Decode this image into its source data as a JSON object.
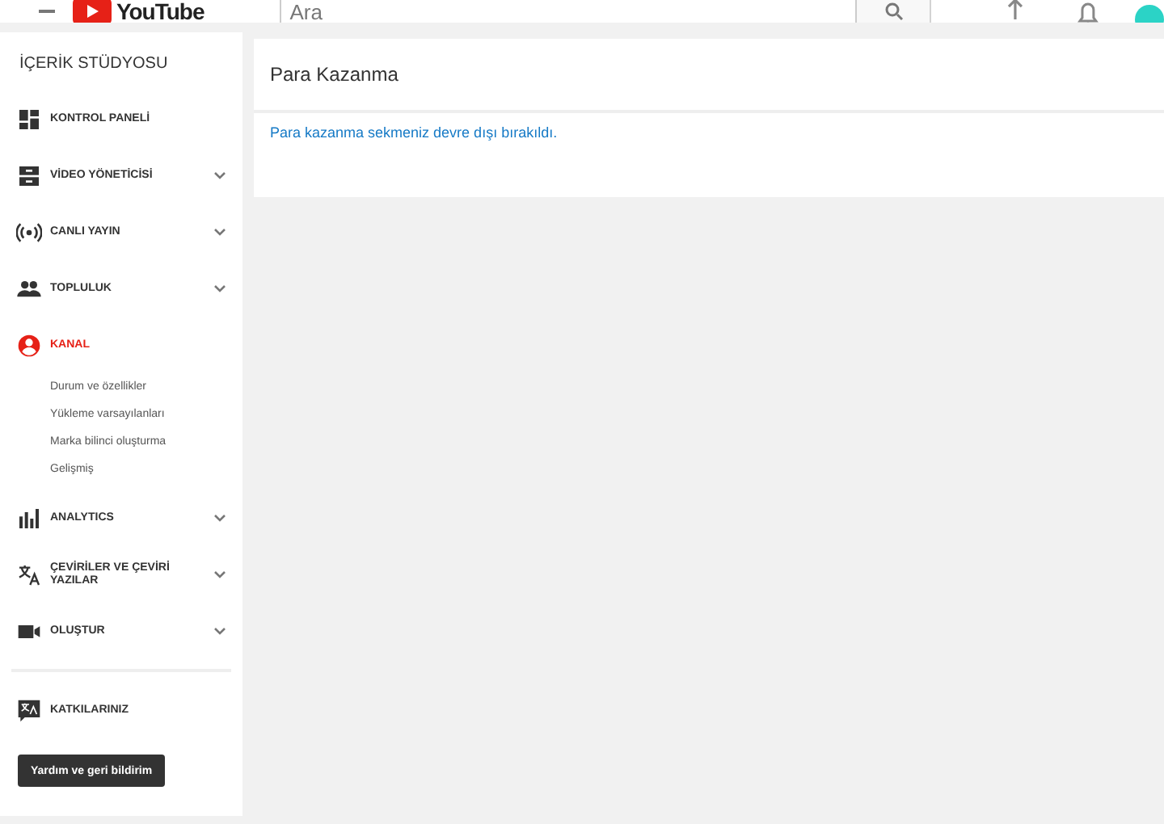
{
  "header": {
    "logo": "YouTube",
    "search": {
      "placeholder": "Ara"
    }
  },
  "sidebar": {
    "title": "İÇERİK STÜDYOSU",
    "items": [
      {
        "label": "KONTROL PANELİ",
        "selected": false,
        "expandable": false
      },
      {
        "label": "VİDEO YÖNETİCİSİ",
        "selected": false,
        "expandable": true
      },
      {
        "label": "CANLI YAYIN",
        "selected": false,
        "expandable": true
      },
      {
        "label": "TOPLULUK",
        "selected": false,
        "expandable": true
      },
      {
        "label": "KANAL",
        "selected": true,
        "expandable": false,
        "children": [
          {
            "label": "Durum ve özellikler"
          },
          {
            "label": "Yükleme varsayılanları"
          },
          {
            "label": "Marka bilinci oluşturma"
          },
          {
            "label": "Gelişmiş"
          }
        ]
      },
      {
        "label": "ANALYTICS",
        "selected": false,
        "expandable": true
      },
      {
        "label": "ÇEVİRİLER VE ÇEVİRİ YAZILAR",
        "selected": false,
        "expandable": true
      },
      {
        "label": "OLUŞTUR",
        "selected": false,
        "expandable": true
      }
    ],
    "contributions": {
      "label": "KATKILARINIZ"
    },
    "help_button": "Yardım ve geri bildirim"
  },
  "main": {
    "title": "Para Kazanma",
    "message": "Para kazanma sekmeniz devre dışı bırakıldı."
  }
}
